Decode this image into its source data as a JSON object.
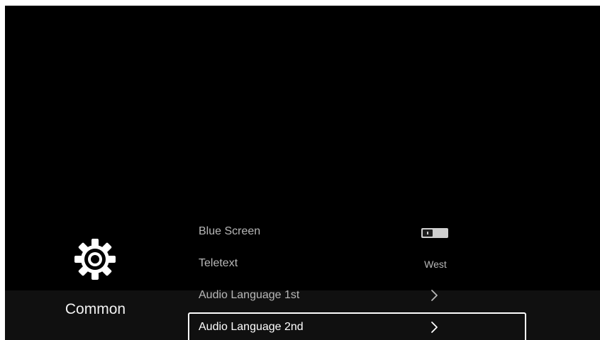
{
  "category": {
    "label": "Common",
    "icon": "gear-icon"
  },
  "menu": {
    "items": [
      {
        "label": "Blue Screen",
        "control": "toggle",
        "value": "off"
      },
      {
        "label": "Teletext",
        "control": "value",
        "value": "West"
      },
      {
        "label": "Audio Language 1st",
        "control": "submenu",
        "icon": "chevron-right-icon"
      },
      {
        "label": "Audio Language 2nd",
        "control": "submenu",
        "icon": "chevron-right-icon",
        "selected": true
      }
    ]
  },
  "colors": {
    "background": "#000000",
    "band": "#101010",
    "text_dim": "#b8b8b8",
    "text_bright": "#ffffff",
    "focus_border": "#ffffff"
  }
}
